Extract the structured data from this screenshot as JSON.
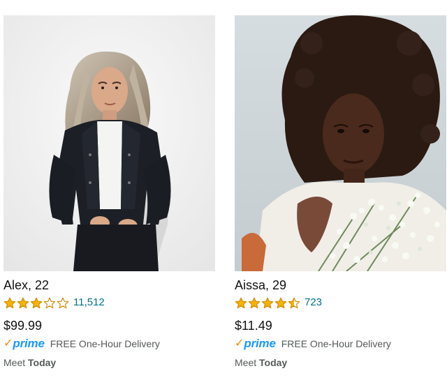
{
  "products": [
    {
      "name": "Alex, 22",
      "rating": 3,
      "rating_max": 5,
      "review_count": "11,512",
      "price": "$99.99",
      "prime_label": "prime",
      "delivery": "FREE One-Hour Delivery",
      "meet_label": "Meet",
      "meet_when": "Today"
    },
    {
      "name": "Aissa, 29",
      "rating": 4.5,
      "rating_max": 5,
      "review_count": "723",
      "price": "$11.49",
      "prime_label": "prime",
      "delivery": "FREE One-Hour Delivery",
      "meet_label": "Meet",
      "meet_when": "Today"
    }
  ],
  "colors": {
    "star_fill": "#f5b400",
    "star_outline": "#d18a00",
    "link": "#007185",
    "prime_blue": "#1a98ff",
    "prime_check": "#f08804",
    "muted_text": "#565959"
  }
}
